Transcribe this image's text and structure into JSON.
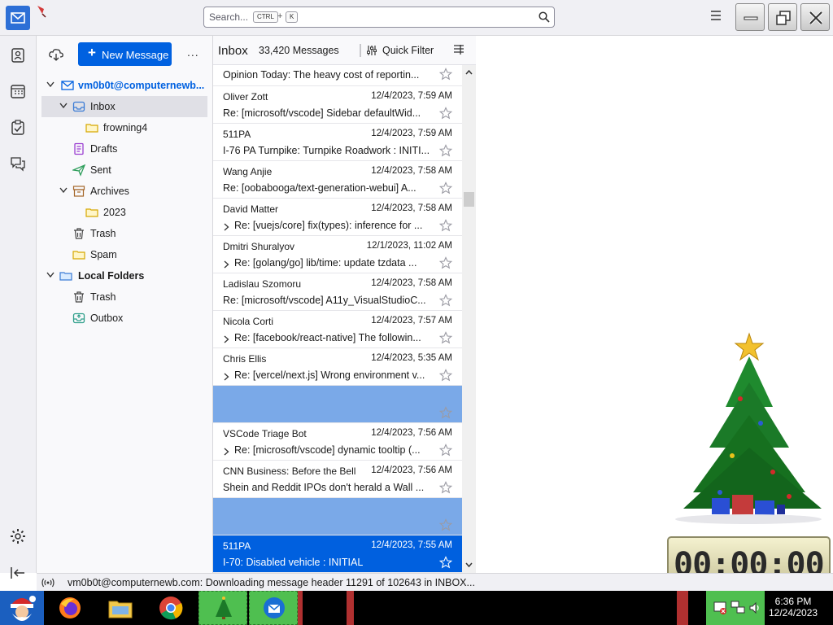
{
  "toolbar": {
    "search_placeholder": "Search...",
    "search_key1": "CTRL",
    "search_plus": "+",
    "search_key2": "K"
  },
  "folder_pane": {
    "new_message": "New Message",
    "more": "...",
    "folders": [
      {
        "label": "vm0b0t@computernewb...",
        "kind": "account"
      },
      {
        "label": "Inbox"
      },
      {
        "label": "frowning4"
      },
      {
        "label": "Drafts"
      },
      {
        "label": "Sent"
      },
      {
        "label": "Archives"
      },
      {
        "label": "2023"
      },
      {
        "label": "Trash"
      },
      {
        "label": "Spam"
      },
      {
        "label": "Local Folders",
        "kind": "local"
      },
      {
        "label": "Trash"
      },
      {
        "label": "Outbox"
      }
    ]
  },
  "thread_pane": {
    "title": "Inbox",
    "count": "33,420 Messages",
    "quick_filter": "Quick Filter",
    "messages": [
      {
        "sender": "",
        "date": "",
        "subject": "Opinion Today: The heavy cost of reportin...",
        "thread": false,
        "state": "normal"
      },
      {
        "sender": "Oliver Zott",
        "date": "12/4/2023, 7:59 AM",
        "subject": "Re: [microsoft/vscode] Sidebar defaultWid...",
        "thread": false,
        "state": "normal"
      },
      {
        "sender": "511PA",
        "date": "12/4/2023, 7:59 AM",
        "subject": "I-76 PA Turnpike: Turnpike Roadwork : INITI...",
        "thread": false,
        "state": "normal"
      },
      {
        "sender": "Wang Anjie",
        "date": "12/4/2023, 7:58 AM",
        "subject": "Re: [oobabooga/text-generation-webui] A...",
        "thread": false,
        "state": "normal"
      },
      {
        "sender": "David Matter",
        "date": "12/4/2023, 7:58 AM",
        "subject": "Re: [vuejs/core] fix(types): inference for ...",
        "thread": true,
        "state": "normal"
      },
      {
        "sender": "Dmitri Shuralyov",
        "date": "12/1/2023, 11:02 AM",
        "subject": "Re: [golang/go] lib/time: update tzdata ...",
        "thread": true,
        "state": "normal"
      },
      {
        "sender": "Ladislau Szomoru",
        "date": "12/4/2023, 7:58 AM",
        "subject": "Re: [microsoft/vscode] A11y_VisualStudioC...",
        "thread": false,
        "state": "normal"
      },
      {
        "sender": "Nicola Corti",
        "date": "12/4/2023, 7:57 AM",
        "subject": "Re: [facebook/react-native] The followin...",
        "thread": true,
        "state": "normal"
      },
      {
        "sender": "Chris Ellis",
        "date": "12/4/2023, 5:35 AM",
        "subject": "Re: [vercel/next.js] Wrong environment v...",
        "thread": true,
        "state": "normal"
      },
      {
        "sender": "",
        "date": "",
        "subject": "",
        "thread": false,
        "state": "faded"
      },
      {
        "sender": "VSCode Triage Bot",
        "date": "12/4/2023, 7:56 AM",
        "subject": "Re: [microsoft/vscode] dynamic tooltip (...",
        "thread": true,
        "state": "normal"
      },
      {
        "sender": "CNN Business: Before the Bell",
        "date": "12/4/2023, 7:56 AM",
        "subject": "Shein and Reddit IPOs don't herald a Wall ...",
        "thread": false,
        "state": "normal"
      },
      {
        "sender": "",
        "date": "",
        "subject": "",
        "thread": false,
        "state": "faded"
      },
      {
        "sender": "511PA",
        "date": "12/4/2023, 7:55 AM",
        "subject": "I-70: Disabled vehicle : INITIAL",
        "thread": false,
        "state": "active"
      }
    ]
  },
  "timer": {
    "display": "00:00:00"
  },
  "statusbar": {
    "text": "vm0b0t@computernewb.com: Downloading message header 11291 of 102643 in INBOX..."
  },
  "taskbar": {
    "time": "6:36 PM",
    "date": "12/24/2023"
  },
  "colors": {
    "accent": "#0061e0",
    "selected_row": "#0060df",
    "faded_row": "#7aa9e8",
    "tray": "#4fbf50"
  }
}
